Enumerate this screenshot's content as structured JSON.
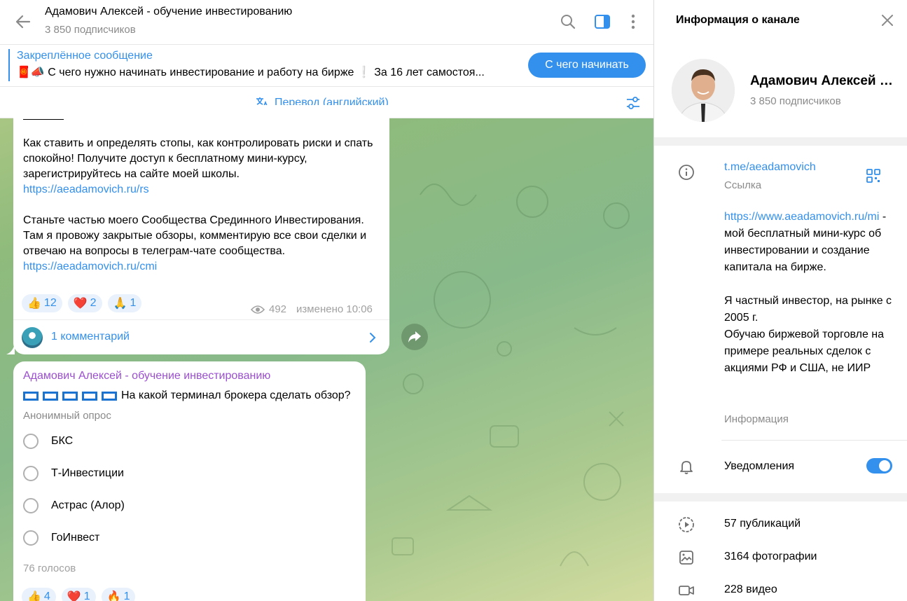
{
  "header": {
    "title": "Адамович Алексей - обучение инвестированию",
    "subscribers": "3 850 подписчиков"
  },
  "pinned": {
    "title": "Закреплённое сообщение",
    "text": "🧧📣 С чего нужно начинать инвестирование и работу на бирже ❕ За 16 лет самостоя...",
    "button": "С чего начинать"
  },
  "translate": {
    "label": "Перевод (английский)"
  },
  "post1": {
    "para1": "Как ставить и определять стопы, как контролировать риски и спать спокойно! Получите доступ к бесплатному мини-курсу, зарегистрируйтесь на сайте моей школы.",
    "link1": "https://aeadamovich.ru/rs",
    "para2": "Станьте частью моего Сообщества Срединного Инвестирования. Там я провожу закрытые обзоры, комментирую все свои сделки и отвечаю на вопросы в телеграм-чате сообщества.",
    "link2": "https://aeadamovich.ru/cmi",
    "reactions": [
      {
        "emoji": "👍",
        "count": "12"
      },
      {
        "emoji": "❤️",
        "count": "2"
      },
      {
        "emoji": "🙏",
        "count": "1"
      }
    ],
    "views": "492",
    "edited": "изменено 10:06",
    "comments": "1 комментарий"
  },
  "post2": {
    "author": "Адамович Алексей - обучение инвестированию",
    "question": "На какой терминал брокера сделать обзор?",
    "poll_type": "Анонимный опрос",
    "options": [
      "БКС",
      "Т-Инвестиции",
      "Астрас (Алор)",
      "ГоИнвест"
    ],
    "votes": "76 голосов",
    "reactions": [
      {
        "emoji": "👍",
        "count": "4"
      },
      {
        "emoji": "❤️",
        "count": "1"
      },
      {
        "emoji": "🔥",
        "count": "1"
      }
    ]
  },
  "sidebar": {
    "title": "Информация о канале",
    "name": "Адамович Алексей - обучение инвестированию",
    "subscribers": "3 850 подписчиков",
    "link": "t.me/aeadamovich",
    "link_caption": "Ссылка",
    "desc_link": "https://www.aeadamovich.ru/mi",
    "desc_text": " - мой бесплатный мини-курс об инвестировании и создание капитала на бирже.\n\nЯ частный инвестор, на рынке с 2005 г.\nОбучаю биржевой торговле на примере реальных сделок с акциями РФ и США, не ИИР",
    "desc_caption": "Информация",
    "notifications": "Уведомления",
    "notifications_on": true,
    "stats": [
      "57 публикаций",
      "3164 фотографии",
      "228 видео"
    ]
  },
  "colors": {
    "accent": "#3390ec",
    "author": "#9b4fd0"
  }
}
